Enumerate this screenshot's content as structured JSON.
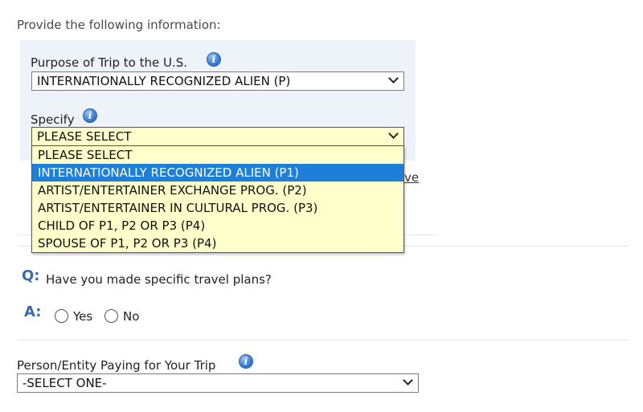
{
  "intro_text": "Provide the following information:",
  "purpose": {
    "label": "Purpose of Trip to the U.S.",
    "value": "INTERNATIONALLY RECOGNIZED ALIEN (P)"
  },
  "specify": {
    "label": "Specify",
    "value": "PLEASE SELECT",
    "options": [
      "PLEASE SELECT",
      "INTERNATIONALLY RECOGNIZED ALIEN (P1)",
      "ARTIST/ENTERTAINER EXCHANGE PROG. (P2)",
      "ARTIST/ENTERTAINER IN CULTURAL PROG. (P3)",
      "CHILD OF P1, P2 OR P3 (P4)",
      "SPOUSE OF P1, P2 OR P3 (P4)"
    ],
    "highlighted_option": "INTERNATIONALLY RECOGNIZED ALIEN (P1)"
  },
  "hidden_link_fragment": "ve",
  "question": {
    "q_marker": "Q:",
    "text": "Have you made specific travel plans?",
    "a_marker": "A:",
    "options": [
      "Yes",
      "No"
    ]
  },
  "payer": {
    "label": "Person/Entity Paying for Your Trip",
    "value": "-SELECT ONE-"
  },
  "info_icon_glyph": "i",
  "colors": {
    "panel_bg": "#eef3f9",
    "dropdown_bg": "#ffffcc",
    "highlight": "#1e7fd9",
    "qa_marker": "#3a6aa8"
  }
}
